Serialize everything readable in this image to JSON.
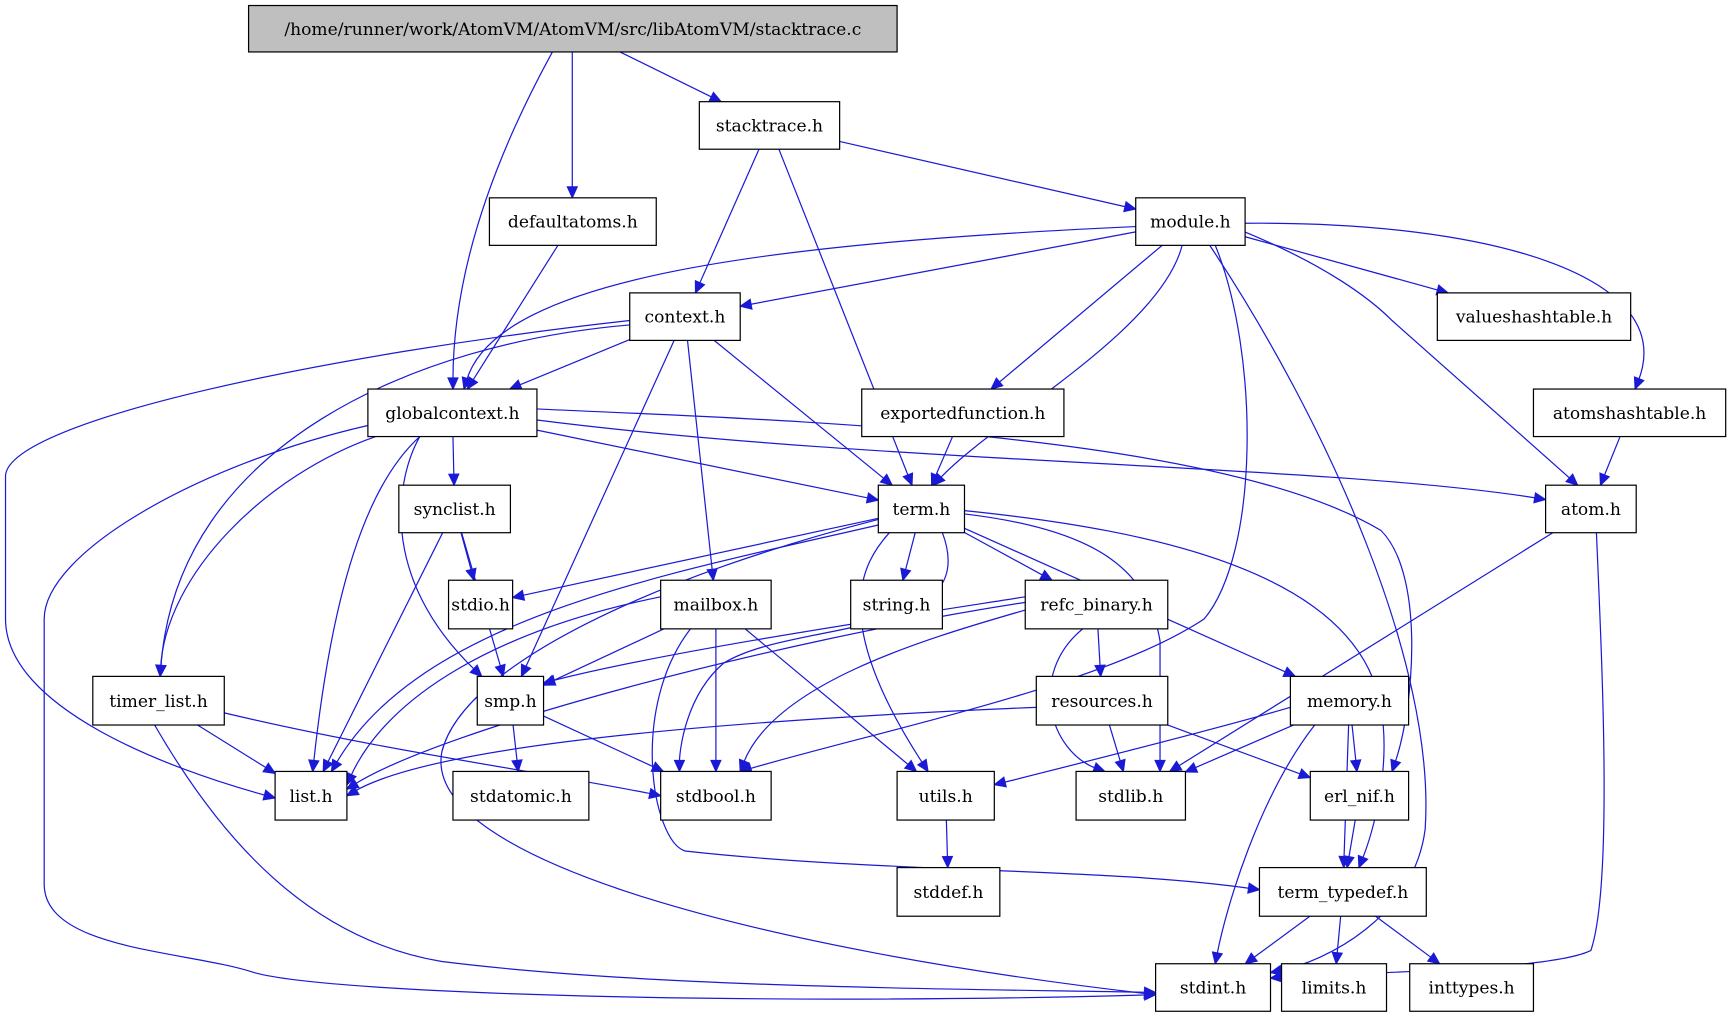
{
  "diagram": {
    "type": "include-dependency-graph",
    "colors": {
      "edge": "#1a1ad6",
      "root_fill": "#bfbfbf",
      "node_fill": "#ffffff",
      "node_border": "#000000"
    },
    "root": "/home/runner/work/AtomVM/AtomVM/src/libAtomVM/stacktrace.c",
    "nodes": [
      {
        "id": "main",
        "label": "/home/runner/work/AtomVM/AtomVM/src/libAtomVM/stacktrace.c"
      },
      {
        "id": "stacktrace",
        "label": "stacktrace.h"
      },
      {
        "id": "defaultatoms",
        "label": "defaultatoms.h"
      },
      {
        "id": "module",
        "label": "module.h"
      },
      {
        "id": "context",
        "label": "context.h"
      },
      {
        "id": "valueshashtable",
        "label": "valueshashtable.h"
      },
      {
        "id": "globalcontext",
        "label": "globalcontext.h"
      },
      {
        "id": "exportedfunction",
        "label": "exportedfunction.h"
      },
      {
        "id": "atomshashtable",
        "label": "atomshashtable.h"
      },
      {
        "id": "term",
        "label": "term.h"
      },
      {
        "id": "atom",
        "label": "atom.h"
      },
      {
        "id": "synclist",
        "label": "synclist.h"
      },
      {
        "id": "stdio",
        "label": "stdio.h"
      },
      {
        "id": "mailbox",
        "label": "mailbox.h"
      },
      {
        "id": "string",
        "label": "string.h"
      },
      {
        "id": "refc_binary",
        "label": "refc_binary.h"
      },
      {
        "id": "timer_list",
        "label": "timer_list.h"
      },
      {
        "id": "smp",
        "label": "smp.h"
      },
      {
        "id": "resources",
        "label": "resources.h"
      },
      {
        "id": "memory",
        "label": "memory.h"
      },
      {
        "id": "list",
        "label": "list.h"
      },
      {
        "id": "stdatomic",
        "label": "stdatomic.h"
      },
      {
        "id": "stdbool",
        "label": "stdbool.h"
      },
      {
        "id": "utils",
        "label": "utils.h"
      },
      {
        "id": "stdlib",
        "label": "stdlib.h"
      },
      {
        "id": "erl_nif",
        "label": "erl_nif.h"
      },
      {
        "id": "stddef",
        "label": "stddef.h"
      },
      {
        "id": "term_typedef",
        "label": "term_typedef.h"
      },
      {
        "id": "stdint",
        "label": "stdint.h"
      },
      {
        "id": "limits",
        "label": "limits.h"
      },
      {
        "id": "inttypes",
        "label": "inttypes.h"
      }
    ],
    "edges": [
      [
        "main",
        "stacktrace"
      ],
      [
        "main",
        "defaultatoms"
      ],
      [
        "main",
        "globalcontext"
      ],
      [
        "stacktrace",
        "module"
      ],
      [
        "stacktrace",
        "context"
      ],
      [
        "stacktrace",
        "term"
      ],
      [
        "defaultatoms",
        "globalcontext"
      ],
      [
        "module",
        "context"
      ],
      [
        "module",
        "globalcontext"
      ],
      [
        "module",
        "valueshashtable"
      ],
      [
        "module",
        "atomshashtable"
      ],
      [
        "module",
        "exportedfunction"
      ],
      [
        "module",
        "term"
      ],
      [
        "module",
        "atom"
      ],
      [
        "module",
        "stdbool"
      ],
      [
        "module",
        "stdint"
      ],
      [
        "context",
        "globalcontext"
      ],
      [
        "context",
        "term"
      ],
      [
        "context",
        "mailbox"
      ],
      [
        "context",
        "smp"
      ],
      [
        "context",
        "timer_list"
      ],
      [
        "context",
        "list"
      ],
      [
        "globalcontext",
        "term"
      ],
      [
        "globalcontext",
        "atom"
      ],
      [
        "globalcontext",
        "synclist"
      ],
      [
        "globalcontext",
        "timer_list"
      ],
      [
        "globalcontext",
        "smp"
      ],
      [
        "globalcontext",
        "list"
      ],
      [
        "globalcontext",
        "stdint"
      ],
      [
        "globalcontext",
        "erl_nif"
      ],
      [
        "exportedfunction",
        "term"
      ],
      [
        "atomshashtable",
        "atom"
      ],
      [
        "atom",
        "stdlib"
      ],
      [
        "atom",
        "stdint"
      ],
      [
        "term",
        "stdio"
      ],
      [
        "term",
        "string"
      ],
      [
        "term",
        "refc_binary"
      ],
      [
        "term",
        "memory"
      ],
      [
        "term",
        "utils"
      ],
      [
        "term",
        "stdbool"
      ],
      [
        "term",
        "stdlib"
      ],
      [
        "term",
        "stdint"
      ],
      [
        "term",
        "term_typedef"
      ],
      [
        "term",
        "list"
      ],
      [
        "synclist",
        "stdio"
      ],
      [
        "synclist",
        "smp"
      ],
      [
        "synclist",
        "list"
      ],
      [
        "mailbox",
        "smp"
      ],
      [
        "mailbox",
        "list"
      ],
      [
        "mailbox",
        "stdbool"
      ],
      [
        "mailbox",
        "utils"
      ],
      [
        "mailbox",
        "term_typedef"
      ],
      [
        "refc_binary",
        "resources"
      ],
      [
        "refc_binary",
        "smp"
      ],
      [
        "refc_binary",
        "stdbool"
      ],
      [
        "refc_binary",
        "stdlib"
      ],
      [
        "refc_binary",
        "list"
      ],
      [
        "timer_list",
        "list"
      ],
      [
        "timer_list",
        "stdbool"
      ],
      [
        "timer_list",
        "stdint"
      ],
      [
        "smp",
        "stdatomic"
      ],
      [
        "smp",
        "stdbool"
      ],
      [
        "resources",
        "list"
      ],
      [
        "resources",
        "stdlib"
      ],
      [
        "resources",
        "erl_nif"
      ],
      [
        "memory",
        "erl_nif"
      ],
      [
        "memory",
        "term_typedef"
      ],
      [
        "memory",
        "utils"
      ],
      [
        "memory",
        "stdlib"
      ],
      [
        "memory",
        "stdint"
      ],
      [
        "utils",
        "stddef"
      ],
      [
        "erl_nif",
        "term_typedef"
      ],
      [
        "term_typedef",
        "stdint"
      ],
      [
        "term_typedef",
        "limits"
      ],
      [
        "term_typedef",
        "inttypes"
      ]
    ]
  }
}
